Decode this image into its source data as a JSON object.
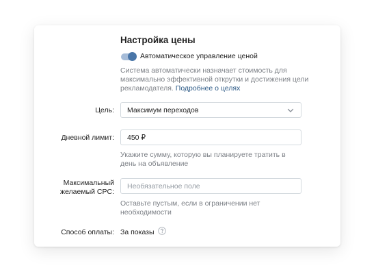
{
  "price": {
    "title": "Настройка цены",
    "auto": {
      "label": "Автоматическое управление ценой",
      "enabled": true,
      "description_lines": [
        "Система автоматически назначает стоимость для",
        "максимально эффективной открутки и достижения цели",
        "рекламодателя."
      ],
      "link": "Подробнее о целях"
    },
    "goal": {
      "label": "Цель:",
      "value": "Максимум переходов",
      "icon": "chevron-down-icon"
    },
    "daily_limit": {
      "label": "Дневной лимит:",
      "value": "450 ₽",
      "hint_lines": [
        "Укажите сумму, которую вы планируете тратить в",
        "день на объявление"
      ]
    },
    "max_cpc": {
      "label_lines": [
        "Максимальный",
        "желаемый CPC:"
      ],
      "placeholder": "Необязательное поле",
      "hint_lines": [
        "Оставьте пустым, если в ограничении нет",
        "необходимости"
      ]
    },
    "payment": {
      "label": "Способ оплаты:",
      "value": "За показы",
      "icon": "help-icon"
    }
  },
  "colors": {
    "accent": "#4a76a8",
    "toggle_track": "#a6bcd8",
    "link": "#2a5885",
    "muted_text": "#7b7f85",
    "border": "#d3d9de"
  }
}
